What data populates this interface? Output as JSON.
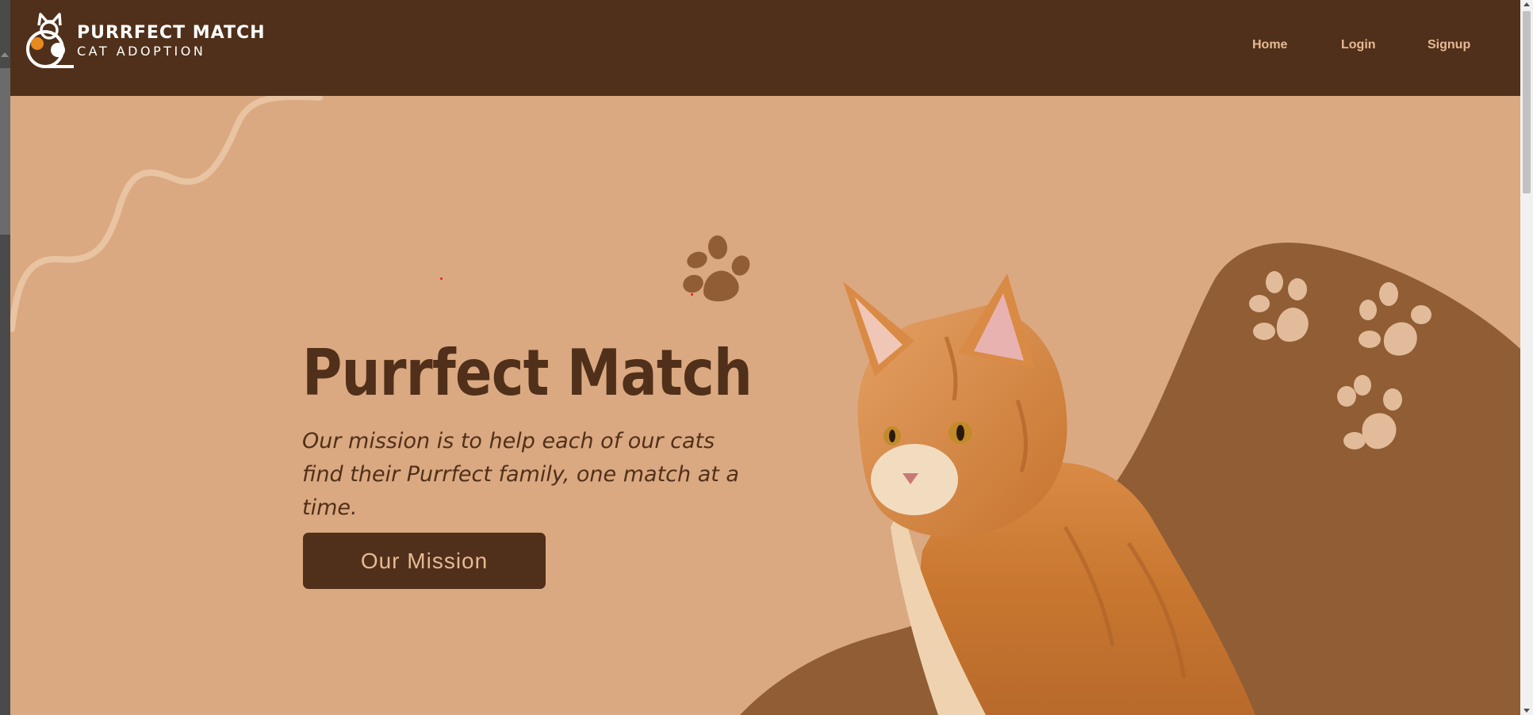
{
  "brand": {
    "title": "PURRFECT MATCH",
    "subtitle": "CAT ADOPTION"
  },
  "nav": {
    "home": "Home",
    "login": "Login",
    "signup": "Signup"
  },
  "hero": {
    "title": "Purrfect Match",
    "subtitle": "Our mission is to help each of our cats find their Purrfect family, one match at a time.",
    "button_label": "Our Mission"
  },
  "colors": {
    "header_bg": "#50301a",
    "page_bg": "#dba981",
    "blob": "#905d34",
    "paw_light": "#e2bc9a",
    "accent_orange": "#e8891e"
  },
  "icons": {
    "logo": "cat-icon",
    "paws": "paw-icon",
    "squiggle": "squiggle-line"
  }
}
